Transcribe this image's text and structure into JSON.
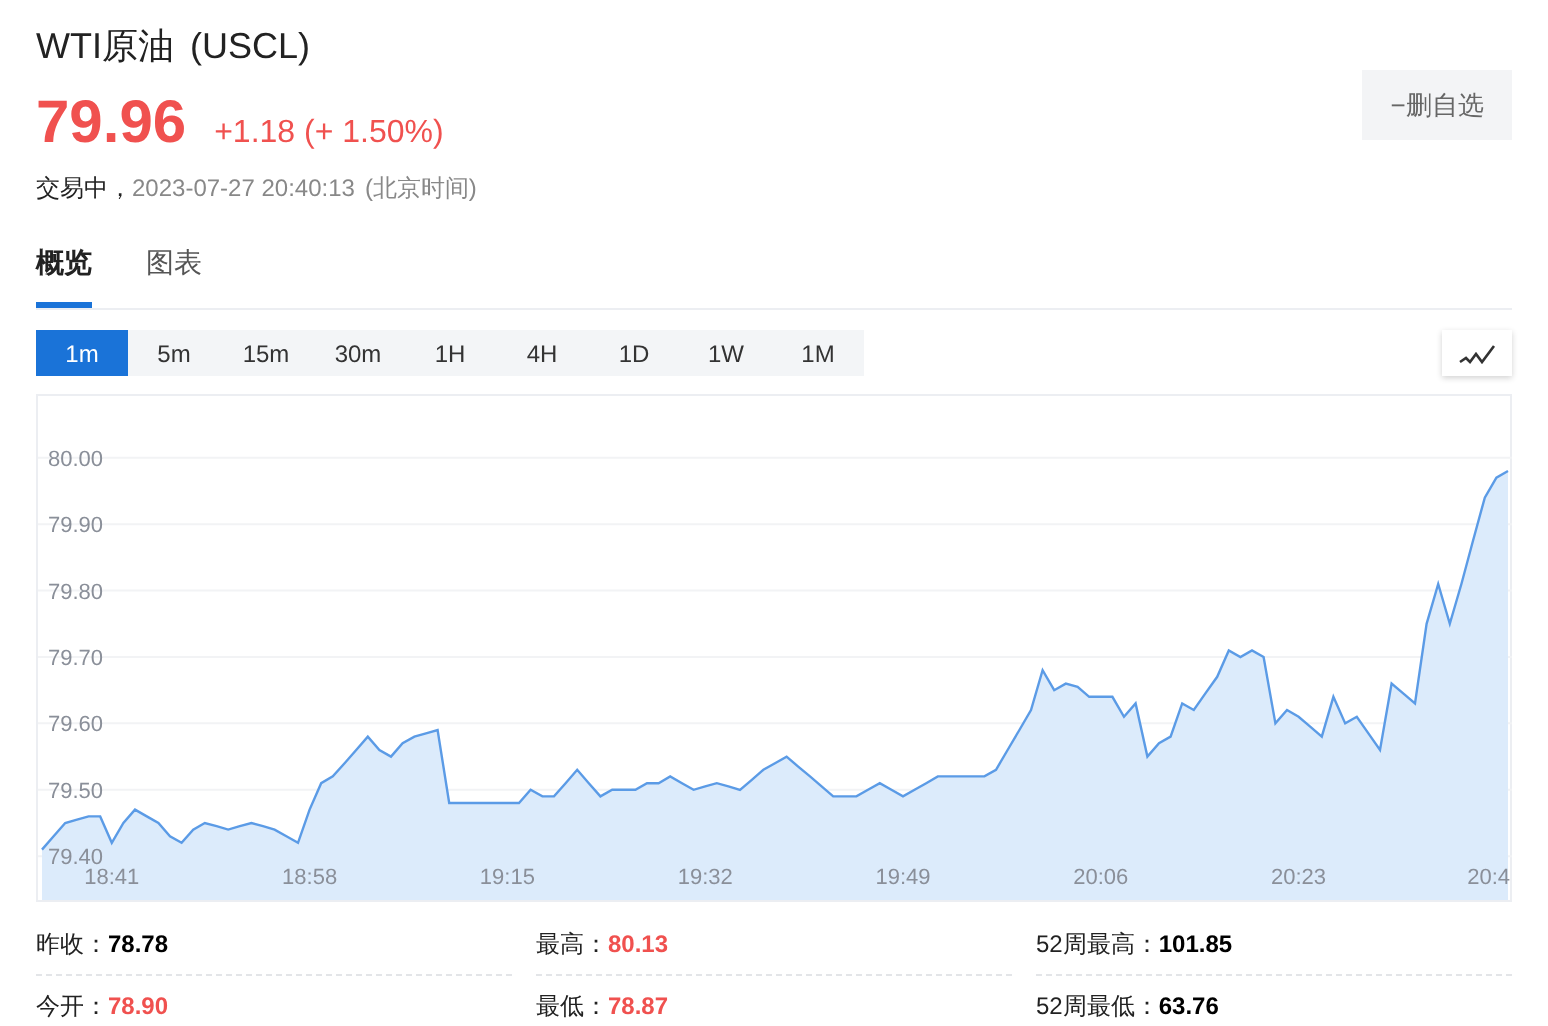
{
  "header": {
    "name": "WTI原油",
    "code": "(USCL)",
    "price": "79.96",
    "change": "+1.18 (+ 1.50%)",
    "up": true,
    "status": "交易中，",
    "time": "2023-07-27 20:40:13",
    "timezone": "(北京时间)",
    "watch_button": "−删自选"
  },
  "tabs": [
    {
      "label": "概览",
      "selected": true
    },
    {
      "label": "图表",
      "selected": false
    }
  ],
  "periods": [
    {
      "label": "1m",
      "selected": true
    },
    {
      "label": "5m",
      "selected": false
    },
    {
      "label": "15m",
      "selected": false
    },
    {
      "label": "30m",
      "selected": false
    },
    {
      "label": "1H",
      "selected": false
    },
    {
      "label": "4H",
      "selected": false
    },
    {
      "label": "1D",
      "selected": false
    },
    {
      "label": "1W",
      "selected": false
    },
    {
      "label": "1M",
      "selected": false
    }
  ],
  "chart": {
    "chart_data": {
      "type": "area",
      "categories": [
        null,
        null,
        null,
        null,
        null,
        null,
        "18:41",
        null,
        null,
        null,
        null,
        null,
        null,
        null,
        null,
        null,
        null,
        null,
        null,
        null,
        null,
        null,
        null,
        "18:58",
        null,
        null,
        null,
        null,
        null,
        null,
        null,
        null,
        null,
        null,
        null,
        null,
        null,
        null,
        null,
        null,
        "19:15",
        null,
        null,
        null,
        null,
        null,
        null,
        null,
        null,
        null,
        null,
        null,
        null,
        null,
        null,
        null,
        null,
        "19:32",
        null,
        null,
        null,
        null,
        null,
        null,
        null,
        null,
        null,
        null,
        null,
        null,
        null,
        null,
        null,
        null,
        "19:49",
        null,
        null,
        null,
        null,
        null,
        null,
        null,
        null,
        null,
        null,
        null,
        null,
        null,
        null,
        null,
        null,
        "20:06",
        null,
        null,
        null,
        null,
        null,
        null,
        null,
        null,
        null,
        null,
        null,
        null,
        null,
        null,
        null,
        null,
        "20:23",
        null,
        null,
        null,
        null,
        null,
        null,
        null,
        null,
        null,
        null,
        null,
        null,
        null,
        null,
        null,
        null,
        "20:4",
        null
      ],
      "series": [
        {
          "color": "#5b9be6",
          "values": [
            79.41,
            79.43,
            79.45,
            79.455,
            79.46,
            79.46,
            79.42,
            79.45,
            79.47,
            79.46,
            79.45,
            79.43,
            79.42,
            79.44,
            79.45,
            79.445,
            79.44,
            79.445,
            79.45,
            79.445,
            79.44,
            79.43,
            79.42,
            79.47,
            79.51,
            79.52,
            79.54,
            79.56,
            79.58,
            79.56,
            79.55,
            79.57,
            79.58,
            79.585,
            79.59,
            79.48,
            79.48,
            79.48,
            79.48,
            79.48,
            79.48,
            79.48,
            79.5,
            79.49,
            79.49,
            79.51,
            79.53,
            79.51,
            79.49,
            79.5,
            79.5,
            79.5,
            79.51,
            79.51,
            79.52,
            79.51,
            79.5,
            79.505,
            79.51,
            79.505,
            79.5,
            79.515,
            79.53,
            79.54,
            79.55,
            79.535,
            79.52,
            79.505,
            79.49,
            79.49,
            79.49,
            79.5,
            79.51,
            79.5,
            79.49,
            79.5,
            79.51,
            79.52,
            79.52,
            79.52,
            79.52,
            79.52,
            79.53,
            79.56,
            79.59,
            79.62,
            79.68,
            79.65,
            79.66,
            79.655,
            79.64,
            79.64,
            79.64,
            79.61,
            79.63,
            79.55,
            79.57,
            79.58,
            79.63,
            79.62,
            79.645,
            79.67,
            79.71,
            79.7,
            79.71,
            79.7,
            79.6,
            79.62,
            79.61,
            79.595,
            79.58,
            79.64,
            79.6,
            79.61,
            79.585,
            79.56,
            79.66,
            79.645,
            79.63,
            79.75,
            79.81,
            79.75,
            79.81,
            79.875,
            79.94,
            79.97,
            79.98
          ]
        }
      ],
      "ylim": [
        79.334,
        80.093
      ],
      "grid": true,
      "yticks": [
        {
          "value": 79.4,
          "label": "79.40"
        },
        {
          "value": 79.5,
          "label": "79.50"
        },
        {
          "value": 79.6,
          "label": "79.60"
        },
        {
          "value": 79.7,
          "label": "79.70"
        },
        {
          "value": 79.8,
          "label": "79.80"
        },
        {
          "value": 79.9,
          "label": "79.90"
        },
        {
          "value": 80.0,
          "label": "80.00"
        }
      ]
    }
  },
  "stats": [
    {
      "label": "昨收：",
      "value": "78.78",
      "color": "#000000"
    },
    {
      "label": "最高：",
      "value": "80.13",
      "color": "#f0514f"
    },
    {
      "label": "52周最高：",
      "value": "101.85",
      "color": "#000000"
    },
    {
      "label": "今开：",
      "value": "78.90",
      "color": "#f0514f"
    },
    {
      "label": "最低：",
      "value": "78.87",
      "color": "#f0514f"
    },
    {
      "label": "52周最低：",
      "value": "63.76",
      "color": "#000000"
    }
  ]
}
